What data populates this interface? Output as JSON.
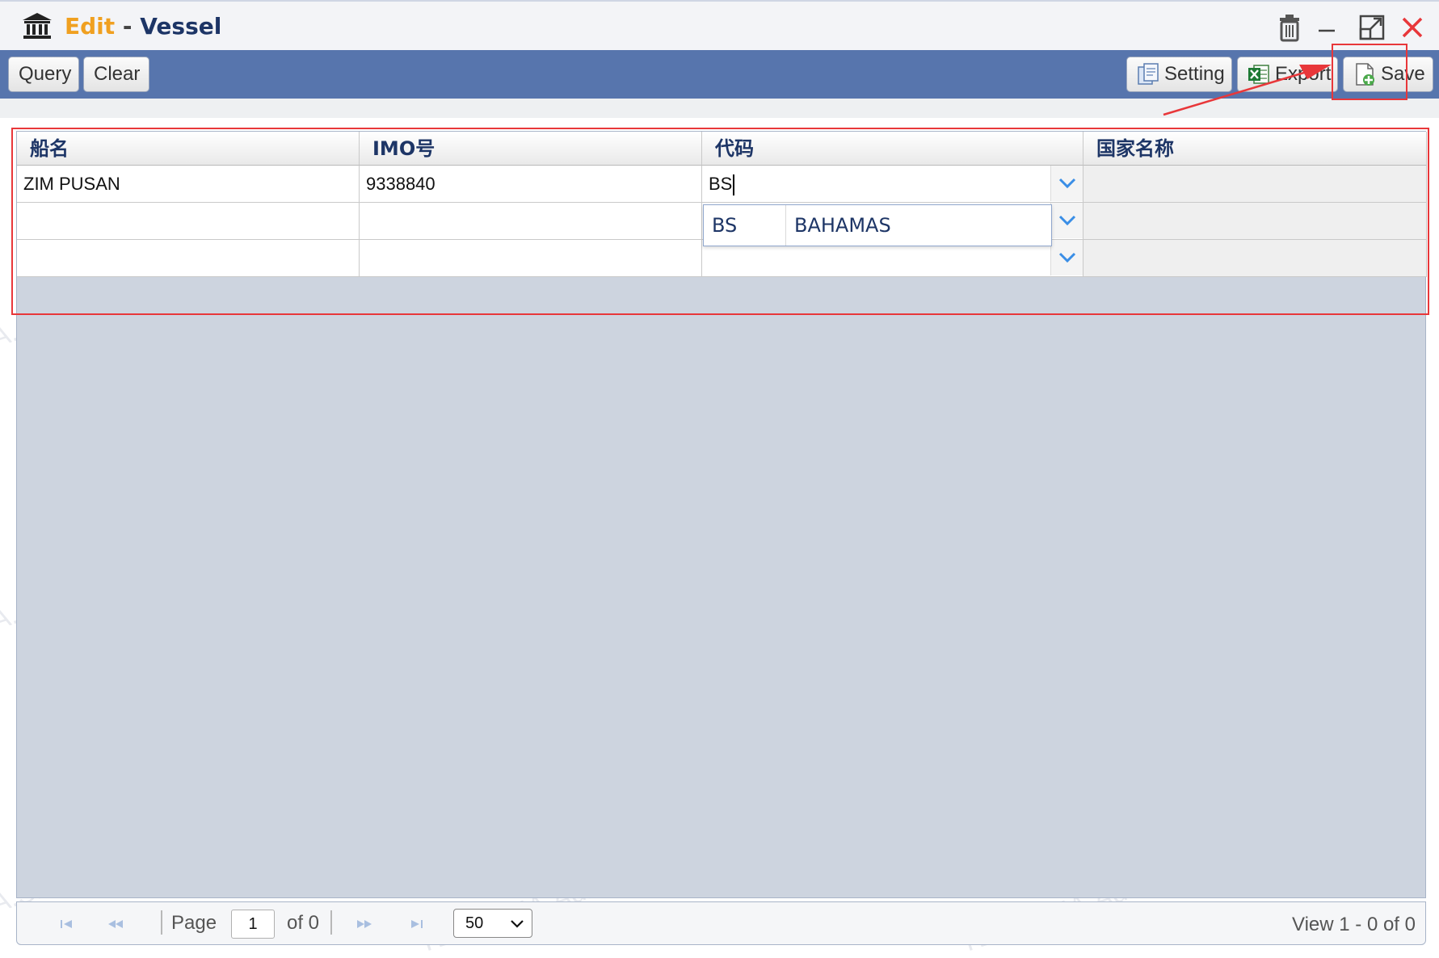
{
  "window": {
    "title_mode": "Edit",
    "title_separator": " - ",
    "title_entity": "Vessel"
  },
  "toolbar": {
    "query_label": "Query",
    "clear_label": "Clear",
    "setting_label": "Setting",
    "export_label": "Export",
    "save_label": "Save"
  },
  "grid": {
    "columns": [
      "船名",
      "IMO号",
      "代码",
      "国家名称"
    ],
    "rows": [
      [
        "ZIM PUSAN",
        "9338840",
        "BS",
        ""
      ],
      [
        "",
        "",
        "",
        ""
      ],
      [
        "",
        "",
        "",
        ""
      ]
    ]
  },
  "autocomplete": {
    "code": "BS",
    "name": "BAHAMAS"
  },
  "pager": {
    "page_label": "Page",
    "page_value": "1",
    "of_label": "of 0",
    "page_size": "50",
    "view_text": "View 1 - 0 of 0"
  },
  "watermark": "TLKA.SHA.Admin 2024-02-22",
  "colors": {
    "toolbar_bg": "#5775ad",
    "grid_bg": "#cdd4df",
    "title_mode": "#f0a020",
    "title_entity": "#1d3566",
    "annotation": "#e8373a"
  },
  "icons": [
    "bank-icon",
    "trash-icon",
    "minimize-icon",
    "maximize-icon",
    "close-icon",
    "setting-icon",
    "excel-icon",
    "save-doc-icon",
    "chevron-down-icon",
    "first-page-icon",
    "prev-page-icon",
    "next-page-icon",
    "last-page-icon"
  ]
}
